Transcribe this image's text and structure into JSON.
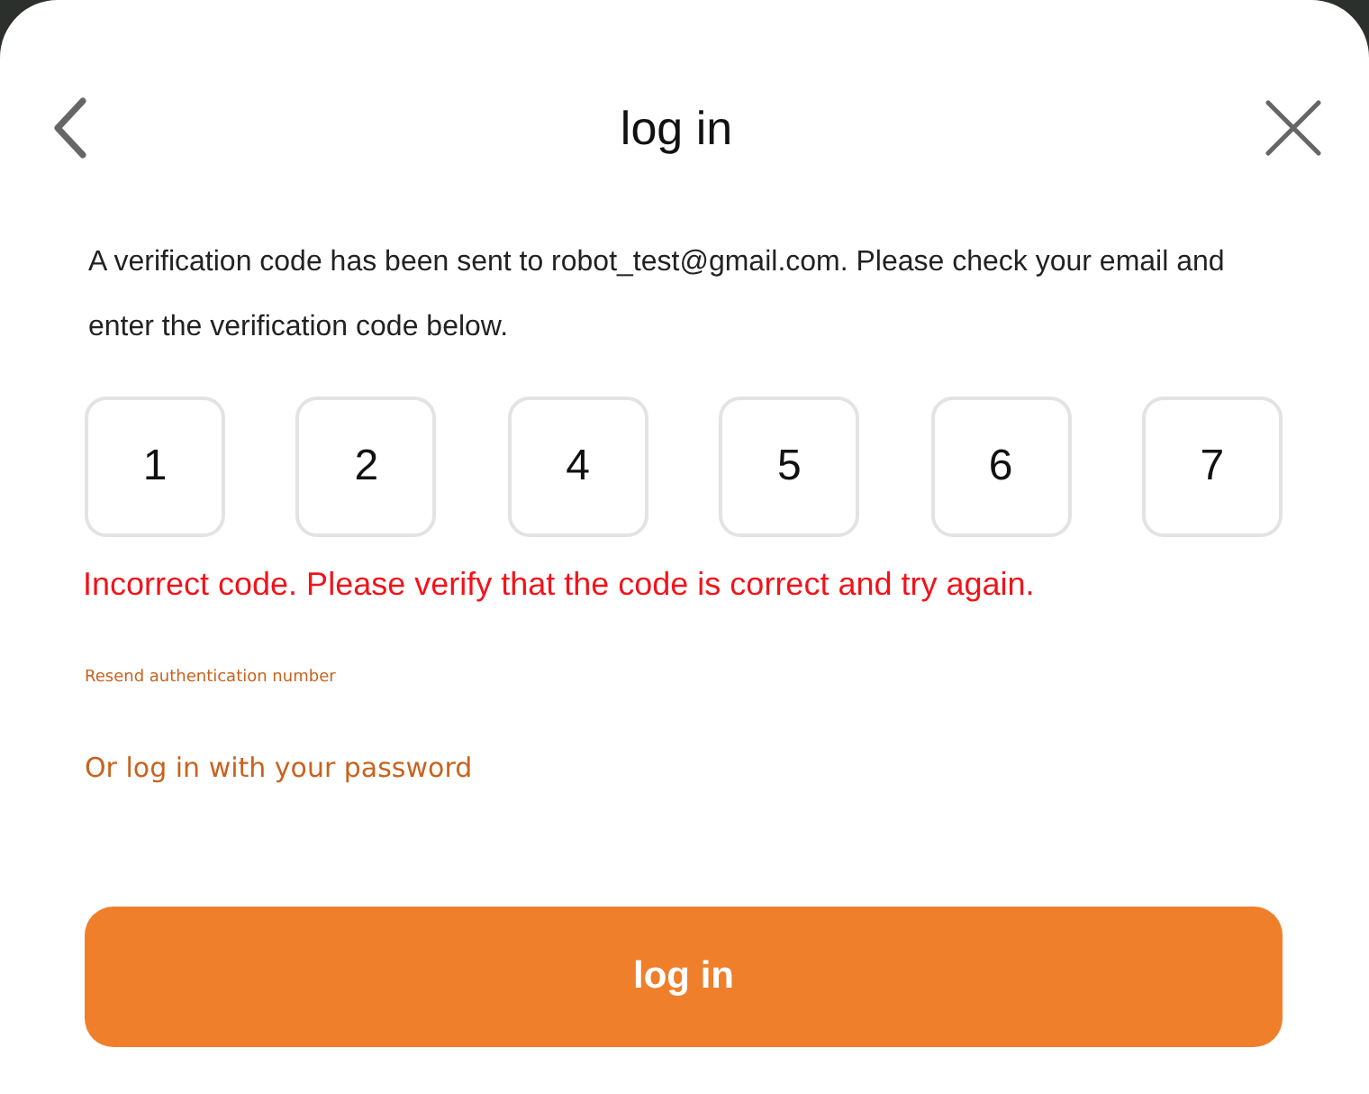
{
  "header": {
    "title": "log in"
  },
  "message": "A verification code has been sent to robot_test@gmail.com. Please check your email and enter the verification code below.",
  "code_digits": [
    "1",
    "2",
    "4",
    "5",
    "6",
    "7"
  ],
  "error": "Incorrect code. Please verify that the code is correct and try again.",
  "resend_link": "Resend authentication number",
  "password_link": "Or log in with your password",
  "login_button": "log in"
}
